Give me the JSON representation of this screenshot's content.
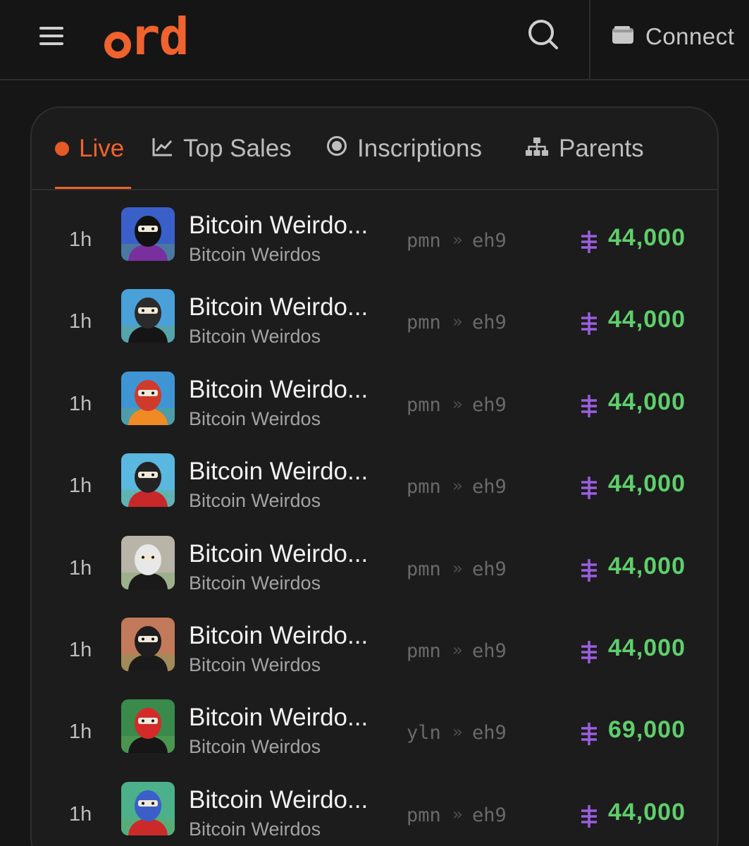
{
  "header": {
    "logo_text": "rd",
    "connect_label": "Connect",
    "brand_color": "#f0622e"
  },
  "tabs": [
    {
      "label": "Live",
      "icon": "live-dot-icon",
      "active": true
    },
    {
      "label": "Top Sales",
      "icon": "chart-icon",
      "active": false
    },
    {
      "label": "Inscriptions",
      "icon": "radio-icon",
      "active": false
    },
    {
      "label": "Parents",
      "icon": "sitemap-icon",
      "active": false
    }
  ],
  "sales": [
    {
      "time": "1h",
      "title": "Bitcoin Weirdo...",
      "collection": "Bitcoin Weirdos",
      "from": "pmn",
      "sep": "»",
      "to": "eh9",
      "price": "44,000",
      "thumb": {
        "bg": "#3a5fc8",
        "face": "#111111",
        "shirt": "#7a2f9e"
      }
    },
    {
      "time": "1h",
      "title": "Bitcoin Weirdo...",
      "collection": "Bitcoin Weirdos",
      "from": "pmn",
      "sep": "»",
      "to": "eh9",
      "price": "44,000",
      "thumb": {
        "bg": "#4aa0d8",
        "face": "#2b2b2b",
        "shirt": "#151515"
      }
    },
    {
      "time": "1h",
      "title": "Bitcoin Weirdo...",
      "collection": "Bitcoin Weirdos",
      "from": "pmn",
      "sep": "»",
      "to": "eh9",
      "price": "44,000",
      "thumb": {
        "bg": "#3f95d4",
        "face": "#d03a2a",
        "shirt": "#f08a25"
      }
    },
    {
      "time": "1h",
      "title": "Bitcoin Weirdo...",
      "collection": "Bitcoin Weirdos",
      "from": "pmn",
      "sep": "»",
      "to": "eh9",
      "price": "44,000",
      "thumb": {
        "bg": "#5ab8e0",
        "face": "#222222",
        "shirt": "#c8282a"
      }
    },
    {
      "time": "1h",
      "title": "Bitcoin Weirdo...",
      "collection": "Bitcoin Weirdos",
      "from": "pmn",
      "sep": "»",
      "to": "eh9",
      "price": "44,000",
      "thumb": {
        "bg": "#b9b4a8",
        "face": "#e8e8e8",
        "shirt": "#1a1a1a"
      }
    },
    {
      "time": "1h",
      "title": "Bitcoin Weirdo...",
      "collection": "Bitcoin Weirdos",
      "from": "pmn",
      "sep": "»",
      "to": "eh9",
      "price": "44,000",
      "thumb": {
        "bg": "#c27a5a",
        "face": "#1e1e1e",
        "shirt": "#1a1a1a"
      }
    },
    {
      "time": "1h",
      "title": "Bitcoin Weirdo...",
      "collection": "Bitcoin Weirdos",
      "from": "yln",
      "sep": "»",
      "to": "eh9",
      "price": "69,000",
      "thumb": {
        "bg": "#3a8a4c",
        "face": "#d42a2a",
        "shirt": "#161616"
      }
    },
    {
      "time": "1h",
      "title": "Bitcoin Weirdo...",
      "collection": "Bitcoin Weirdos",
      "from": "pmn",
      "sep": "»",
      "to": "eh9",
      "price": "44,000",
      "thumb": {
        "bg": "#4cb08a",
        "face": "#3a5fc8",
        "shirt": "#cc2a2a"
      }
    }
  ],
  "colors": {
    "price": "#5fce6c",
    "btc_symbol": "#9b5fe0",
    "accent": "#f0622e"
  }
}
